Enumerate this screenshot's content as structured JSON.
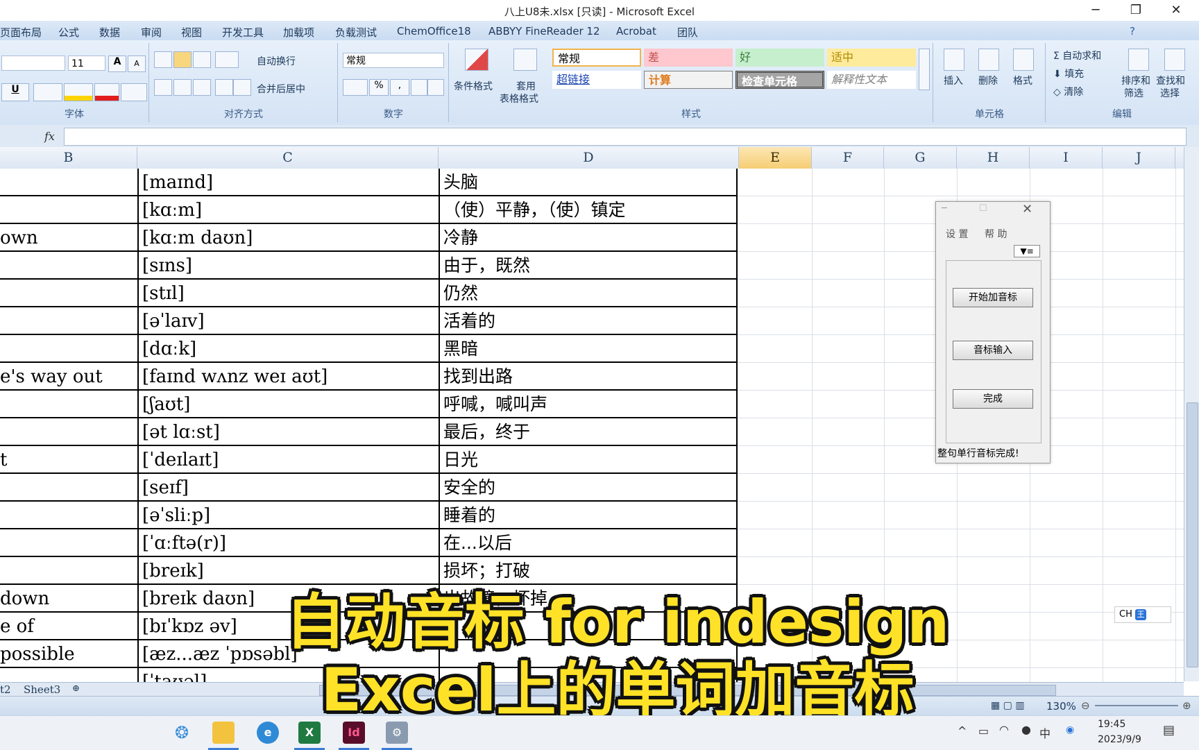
{
  "window": {
    "title": "八上U8未.xlsx  [只读] - Microsoft Excel",
    "minimize": "─",
    "restore": "❐",
    "close": "✕"
  },
  "menu": [
    "页面布局",
    "公式",
    "数据",
    "审阅",
    "视图",
    "开发工具",
    "加载项",
    "负载测试",
    "ChemOffice18",
    "ABBYY FineReader 12",
    "Acrobat",
    "团队"
  ],
  "ribbon": {
    "font": {
      "size": "11",
      "group_label": "字体",
      "grow": "A",
      "shrink": "A",
      "underline": "U"
    },
    "alignment": {
      "wrap": "自动换行",
      "merge": "合并后居中",
      "group_label": "对齐方式"
    },
    "number": {
      "format": "常规",
      "percent": "%",
      "comma": ",",
      "group_label": "数字"
    },
    "styles": {
      "cond_format": "条件格式",
      "table_format_1": "套用",
      "table_format_2": "表格格式",
      "cells": [
        "常规",
        "差",
        "好",
        "适中",
        "超链接",
        "计算",
        "检查单元格",
        "解释性文本"
      ],
      "group_label": "样式"
    },
    "cells_group": {
      "insert": "插入",
      "delete": "删除",
      "format": "格式",
      "group_label": "单元格"
    },
    "editing": {
      "autosum": "自动求和",
      "fill": "填充",
      "clear": "清除",
      "sort_1": "排序和",
      "sort_2": "筛选",
      "find_1": "查找和",
      "find_2": "选择",
      "group_label": "编辑"
    }
  },
  "formula": {
    "fx": "fx",
    "value": ""
  },
  "columns": [
    "B",
    "C",
    "D",
    "E",
    "F",
    "G",
    "H",
    "I",
    "J"
  ],
  "rows": [
    {
      "b": "",
      "c": "[maɪnd]",
      "d": "头脑"
    },
    {
      "b": "",
      "c": "[kɑːm]",
      "d": "（使）平静，（使）镇定"
    },
    {
      "b": "own",
      "c": "[kɑːm daʊn]",
      "d": "冷静"
    },
    {
      "b": "",
      "c": "[sɪns]",
      "d": "由于，既然"
    },
    {
      "b": "",
      "c": "[stɪl]",
      "d": "仍然"
    },
    {
      "b": "",
      "c": "[əˈlaɪv]",
      "d": "活着的"
    },
    {
      "b": "",
      "c": "[dɑːk]",
      "d": "黑暗"
    },
    {
      "b": "e's way out",
      "c": "[faɪnd wʌnz weɪ aʊt]",
      "d": "找到出路"
    },
    {
      "b": "",
      "c": "[ʃaʊt]",
      "d": "呼喊，喊叫声"
    },
    {
      "b": "",
      "c": "[ət lɑːst]",
      "d": "最后，终于"
    },
    {
      "b": "t",
      "c": "[ˈdeɪlaɪt]",
      "d": "日光"
    },
    {
      "b": "",
      "c": "[seɪf]",
      "d": "安全的"
    },
    {
      "b": "",
      "c": "[əˈsliːp]",
      "d": "睡着的"
    },
    {
      "b": "",
      "c": "[ˈɑːftə(r)]",
      "d": "在...以后"
    },
    {
      "b": "",
      "c": "[breɪk]",
      "d": "损坏；打破"
    },
    {
      "b": "down",
      "c": "[breɪk daʊn]",
      "d": "出故障，坏掉"
    },
    {
      "b": "e of",
      "c": "[bɪˈkɒz əv]",
      "d": ""
    },
    {
      "b": "possible",
      "c": "[æz...æz ˈpɒsəbl]",
      "d": ""
    },
    {
      "b": "",
      "c": "[ˈtaʊəl]",
      "d": ""
    }
  ],
  "sheet_tabs": [
    "t2",
    "Sheet3"
  ],
  "status": {
    "zoom": "130%"
  },
  "floating_window": {
    "menu_settings": "设 置",
    "menu_help": "帮 助",
    "dropdown": "▼≡",
    "btn_start": "开始加音标",
    "btn_input": "音标输入",
    "btn_done": "完成",
    "status": "整句单行音标完成!"
  },
  "ime": {
    "lang": "CH"
  },
  "caption": {
    "line1": "自动音标 for indesign",
    "line2": "Excel上的单词加音标"
  },
  "taskbar": {
    "time": "19:45",
    "date": "2023/9/9",
    "ime": "中"
  }
}
